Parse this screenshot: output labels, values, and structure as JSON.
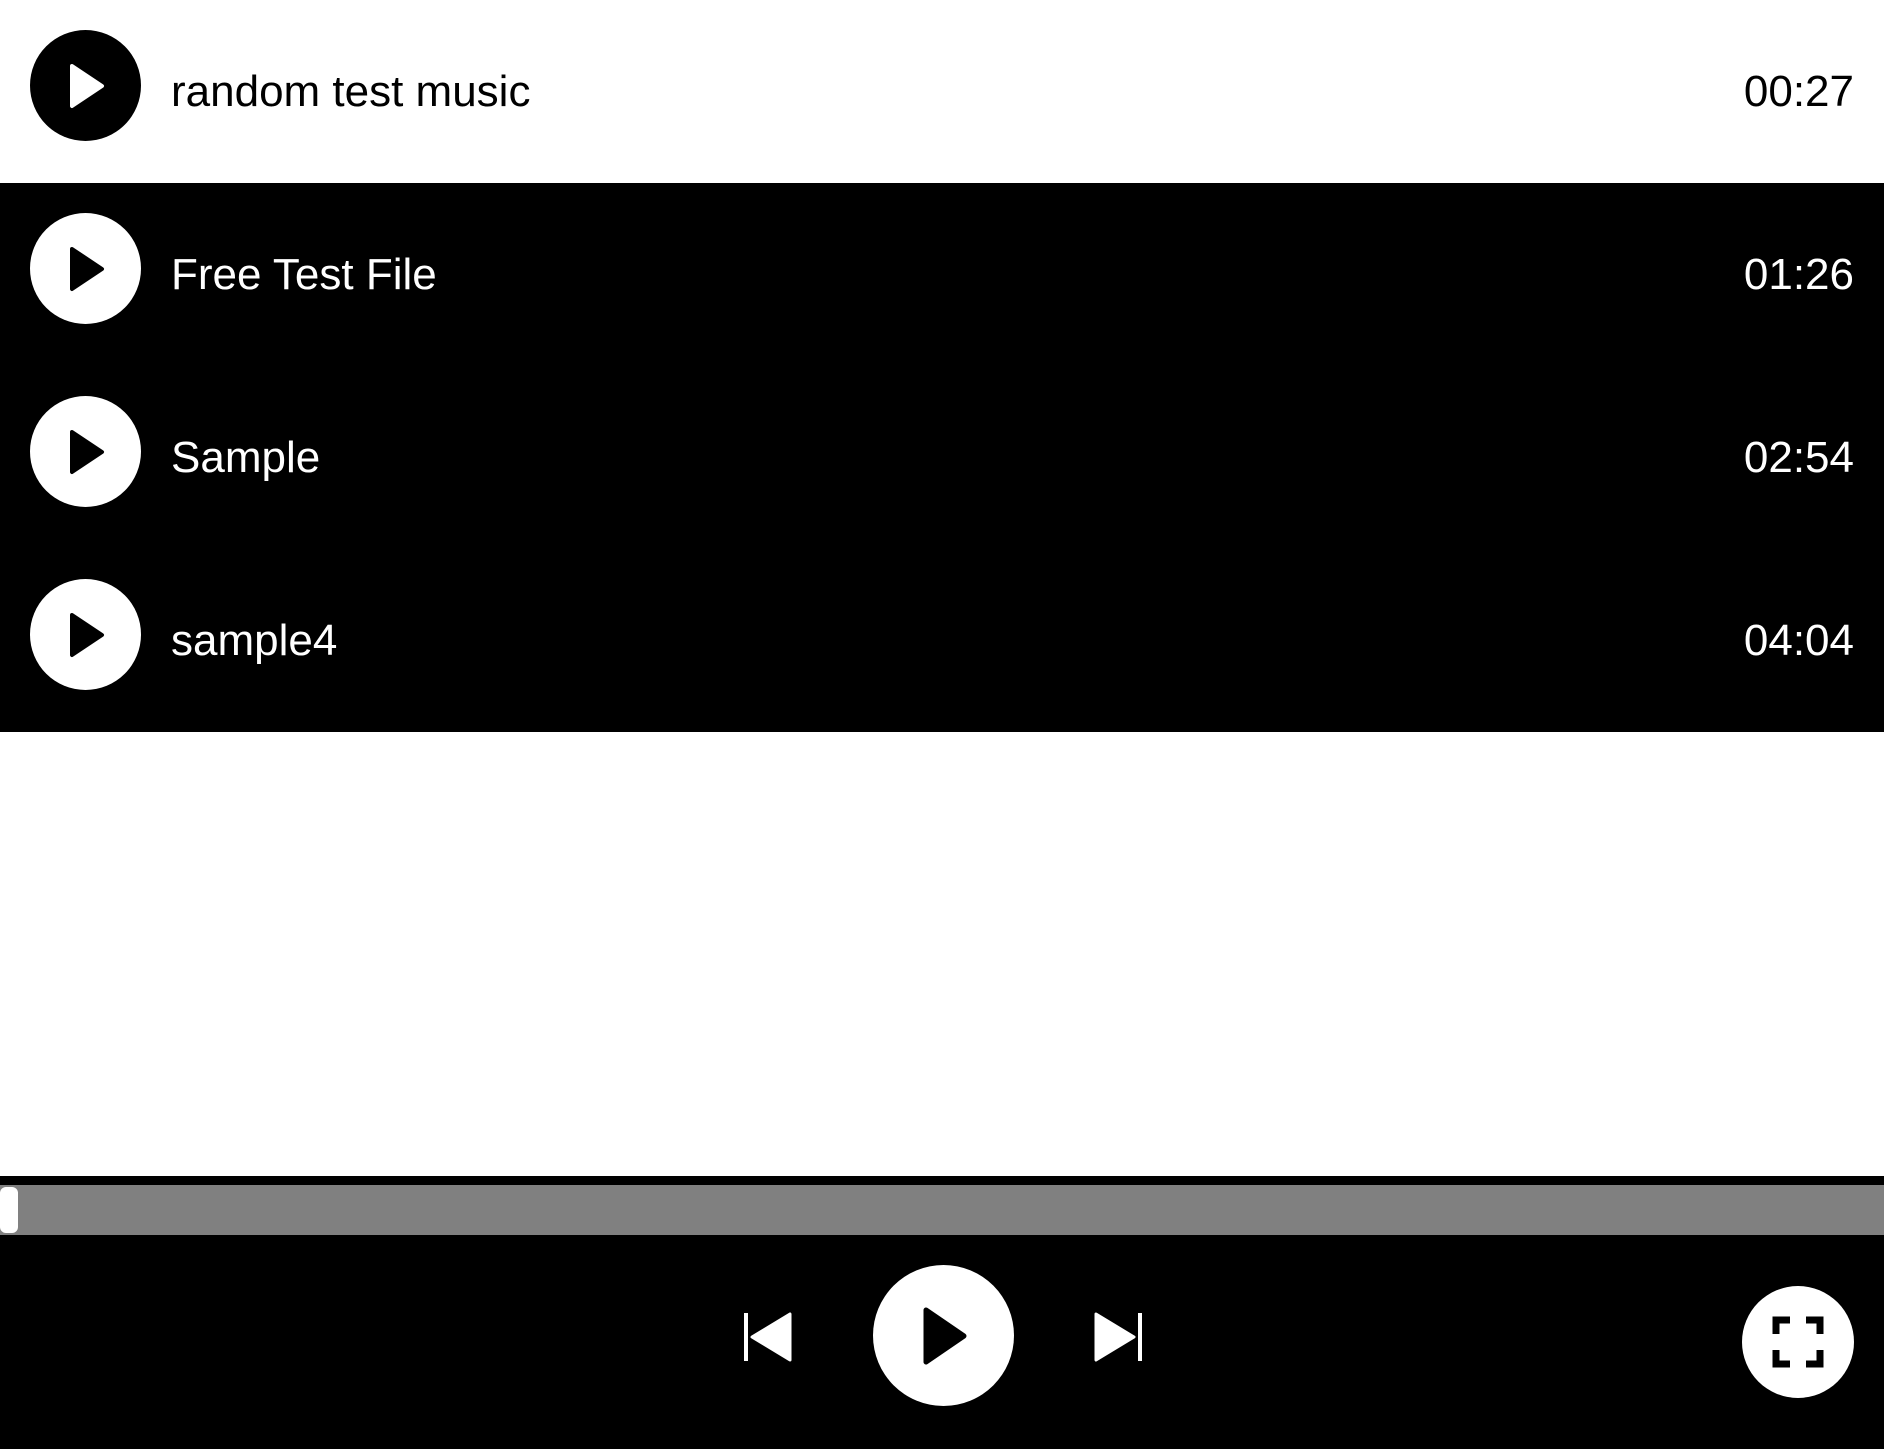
{
  "playlist": {
    "tracks": [
      {
        "title": "random test music",
        "duration": "00:27",
        "selected": true
      },
      {
        "title": "Free Test File",
        "duration": "01:26",
        "selected": false
      },
      {
        "title": "Sample",
        "duration": "02:54",
        "selected": false
      },
      {
        "title": "sample4",
        "duration": "04:04",
        "selected": false
      }
    ]
  },
  "player": {
    "progress_fraction": 0.0,
    "controls": {
      "previous_icon": "skip-previous-icon",
      "play_icon": "play-icon",
      "next_icon": "skip-next-icon",
      "fullscreen_icon": "fullscreen-icon"
    }
  },
  "colors": {
    "background": "#ffffff",
    "foreground": "#000000",
    "progress_track": "#808080",
    "progress_fill": "#ffffff"
  }
}
